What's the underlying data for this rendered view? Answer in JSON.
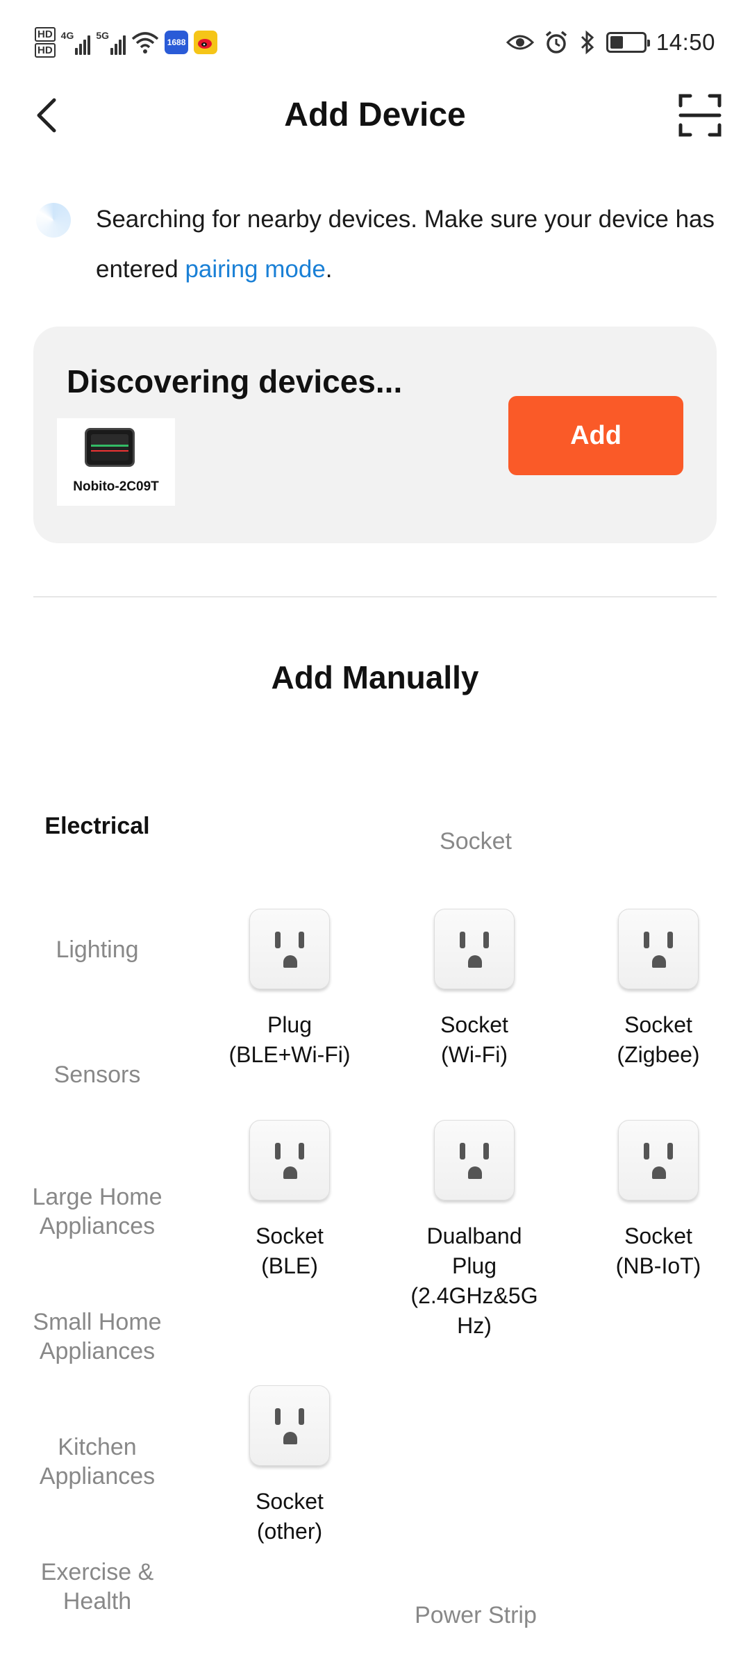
{
  "status_bar": {
    "time": "14:50",
    "signal_1_label": "4G",
    "signal_2_label": "5G",
    "app_badge_1": "1688",
    "hd_1": "HD",
    "hd_2": "HD"
  },
  "header": {
    "title": "Add Device"
  },
  "notice": {
    "text_before": "Searching for nearby devices. Make sure your device has entered ",
    "link": "pairing mode",
    "text_after": "."
  },
  "discovering": {
    "title": "Discovering devices...",
    "device_name": "Nobito-2C09T",
    "add_label": "Add"
  },
  "manual": {
    "title": "Add Manually"
  },
  "categories": [
    "Electrical",
    "Lighting",
    "Sensors",
    "Large Home Appliances",
    "Small Home Appliances",
    "Kitchen Appliances",
    "Exercise & Health"
  ],
  "sections": {
    "socket": "Socket",
    "power_strip": "Power Strip"
  },
  "devices": [
    {
      "label": "Plug\n(BLE+Wi-Fi)"
    },
    {
      "label": "Socket\n(Wi-Fi)"
    },
    {
      "label": "Socket\n(Zigbee)"
    },
    {
      "label": "Socket\n(BLE)"
    },
    {
      "label": "Dualband\nPlug\n(2.4GHz&5G\nHz)"
    },
    {
      "label": "Socket\n(NB-IoT)"
    },
    {
      "label": "Socket\n(other)"
    }
  ],
  "colors": {
    "accent": "#fa5a28",
    "link": "#1a80d6",
    "card_bg": "#f2f2f2"
  }
}
